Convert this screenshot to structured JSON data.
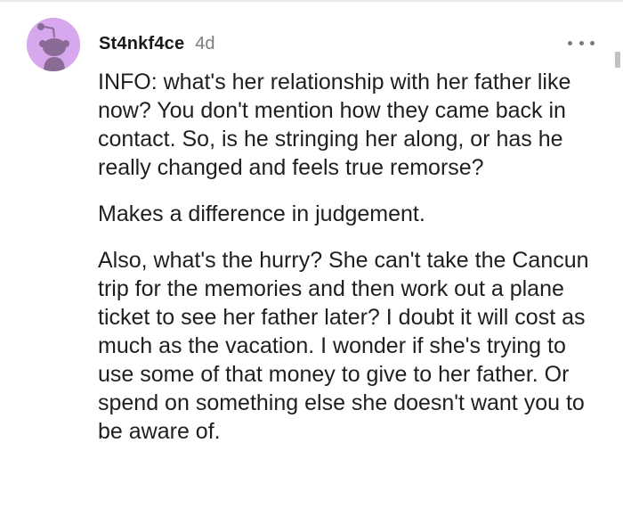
{
  "comment": {
    "username": "St4nkf4ce",
    "timestamp": "4d",
    "more_icon": "more-horizontal-icon",
    "avatar_icon": "reddit-snoo-avatar-icon",
    "avatar_color": "#d8a8ee",
    "paragraphs": [
      "INFO: what's her relationship with her father like now? You don't mention how they came back in contact. So, is he stringing her along, or has he really changed and feels true remorse?",
      "Makes a difference in judgement.",
      "Also, what's the hurry? She can't take the Cancun trip for the memories and then work out a plane ticket to see her father later? I doubt it will cost as much as the vacation. I wonder if she's trying to use some of that money to give to her father. Or spend on something else she doesn't want you to be aware of."
    ]
  }
}
